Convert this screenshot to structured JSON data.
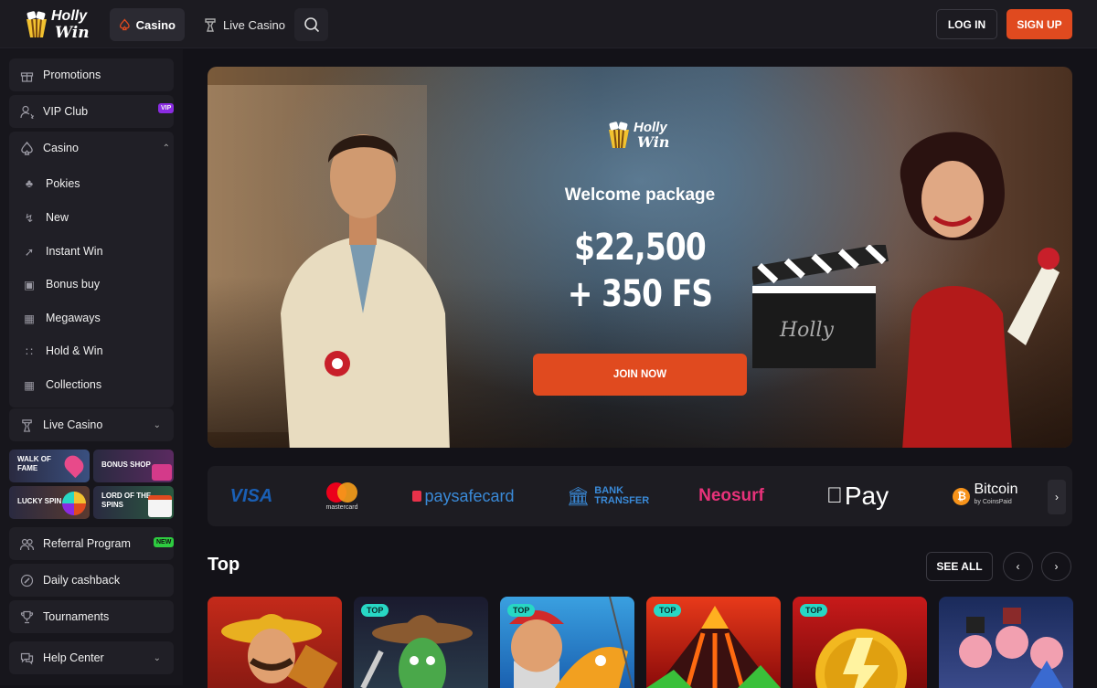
{
  "brand": {
    "line1": "Holly",
    "line2": "Win"
  },
  "topnav": {
    "casino": "Casino",
    "live_casino": "Live Casino",
    "login": "LOG IN",
    "signup": "SIGN UP"
  },
  "sidebar": {
    "promotions": "Promotions",
    "vip_club": "VIP Club",
    "vip_badge": "VIP",
    "casino": "Casino",
    "casino_items": [
      {
        "label": "Pokies",
        "icon": "clover-icon"
      },
      {
        "label": "New",
        "icon": "bolt-icon"
      },
      {
        "label": "Instant Win",
        "icon": "rocket-icon"
      },
      {
        "label": "Bonus buy",
        "icon": "gift-icon"
      },
      {
        "label": "Megaways",
        "icon": "megaways-icon"
      },
      {
        "label": "Hold & Win",
        "icon": "dots-icon"
      },
      {
        "label": "Collections",
        "icon": "grid-icon"
      }
    ],
    "live_casino": "Live Casino",
    "tiles": {
      "walk_of_fame": "WALK OF FAME",
      "bonus_shop": "BONUS SHOP",
      "lucky_spin": "LUCKY SPIN",
      "lord_of_spins": "LORD OF THE SPINS"
    },
    "referral": "Referral Program",
    "new_badge": "NEW",
    "daily_cashback": "Daily cashback",
    "tournaments": "Tournaments",
    "help_center": "Help Center"
  },
  "banner": {
    "title": "Welcome package",
    "amount_line1": "$22,500",
    "amount_line2": "+ 350 FS",
    "cta": "JOIN NOW"
  },
  "payments": {
    "visa": "VISA",
    "mastercard": "mastercard",
    "paysafecard": "paysafecard",
    "bank1": "BANK",
    "bank2": "TRANSFER",
    "neosurf": "Neosurf",
    "applepay": "Pay",
    "bitcoin": "Bitcoin",
    "coinspaid": "by CoinsPaid"
  },
  "top_section": {
    "title": "Top",
    "see_all": "SEE ALL",
    "tag": "TOP"
  },
  "colors": {
    "accent": "#e04a1f",
    "tag": "#28d7c4",
    "vip": "#8a2be2",
    "new": "#2ecc40"
  }
}
